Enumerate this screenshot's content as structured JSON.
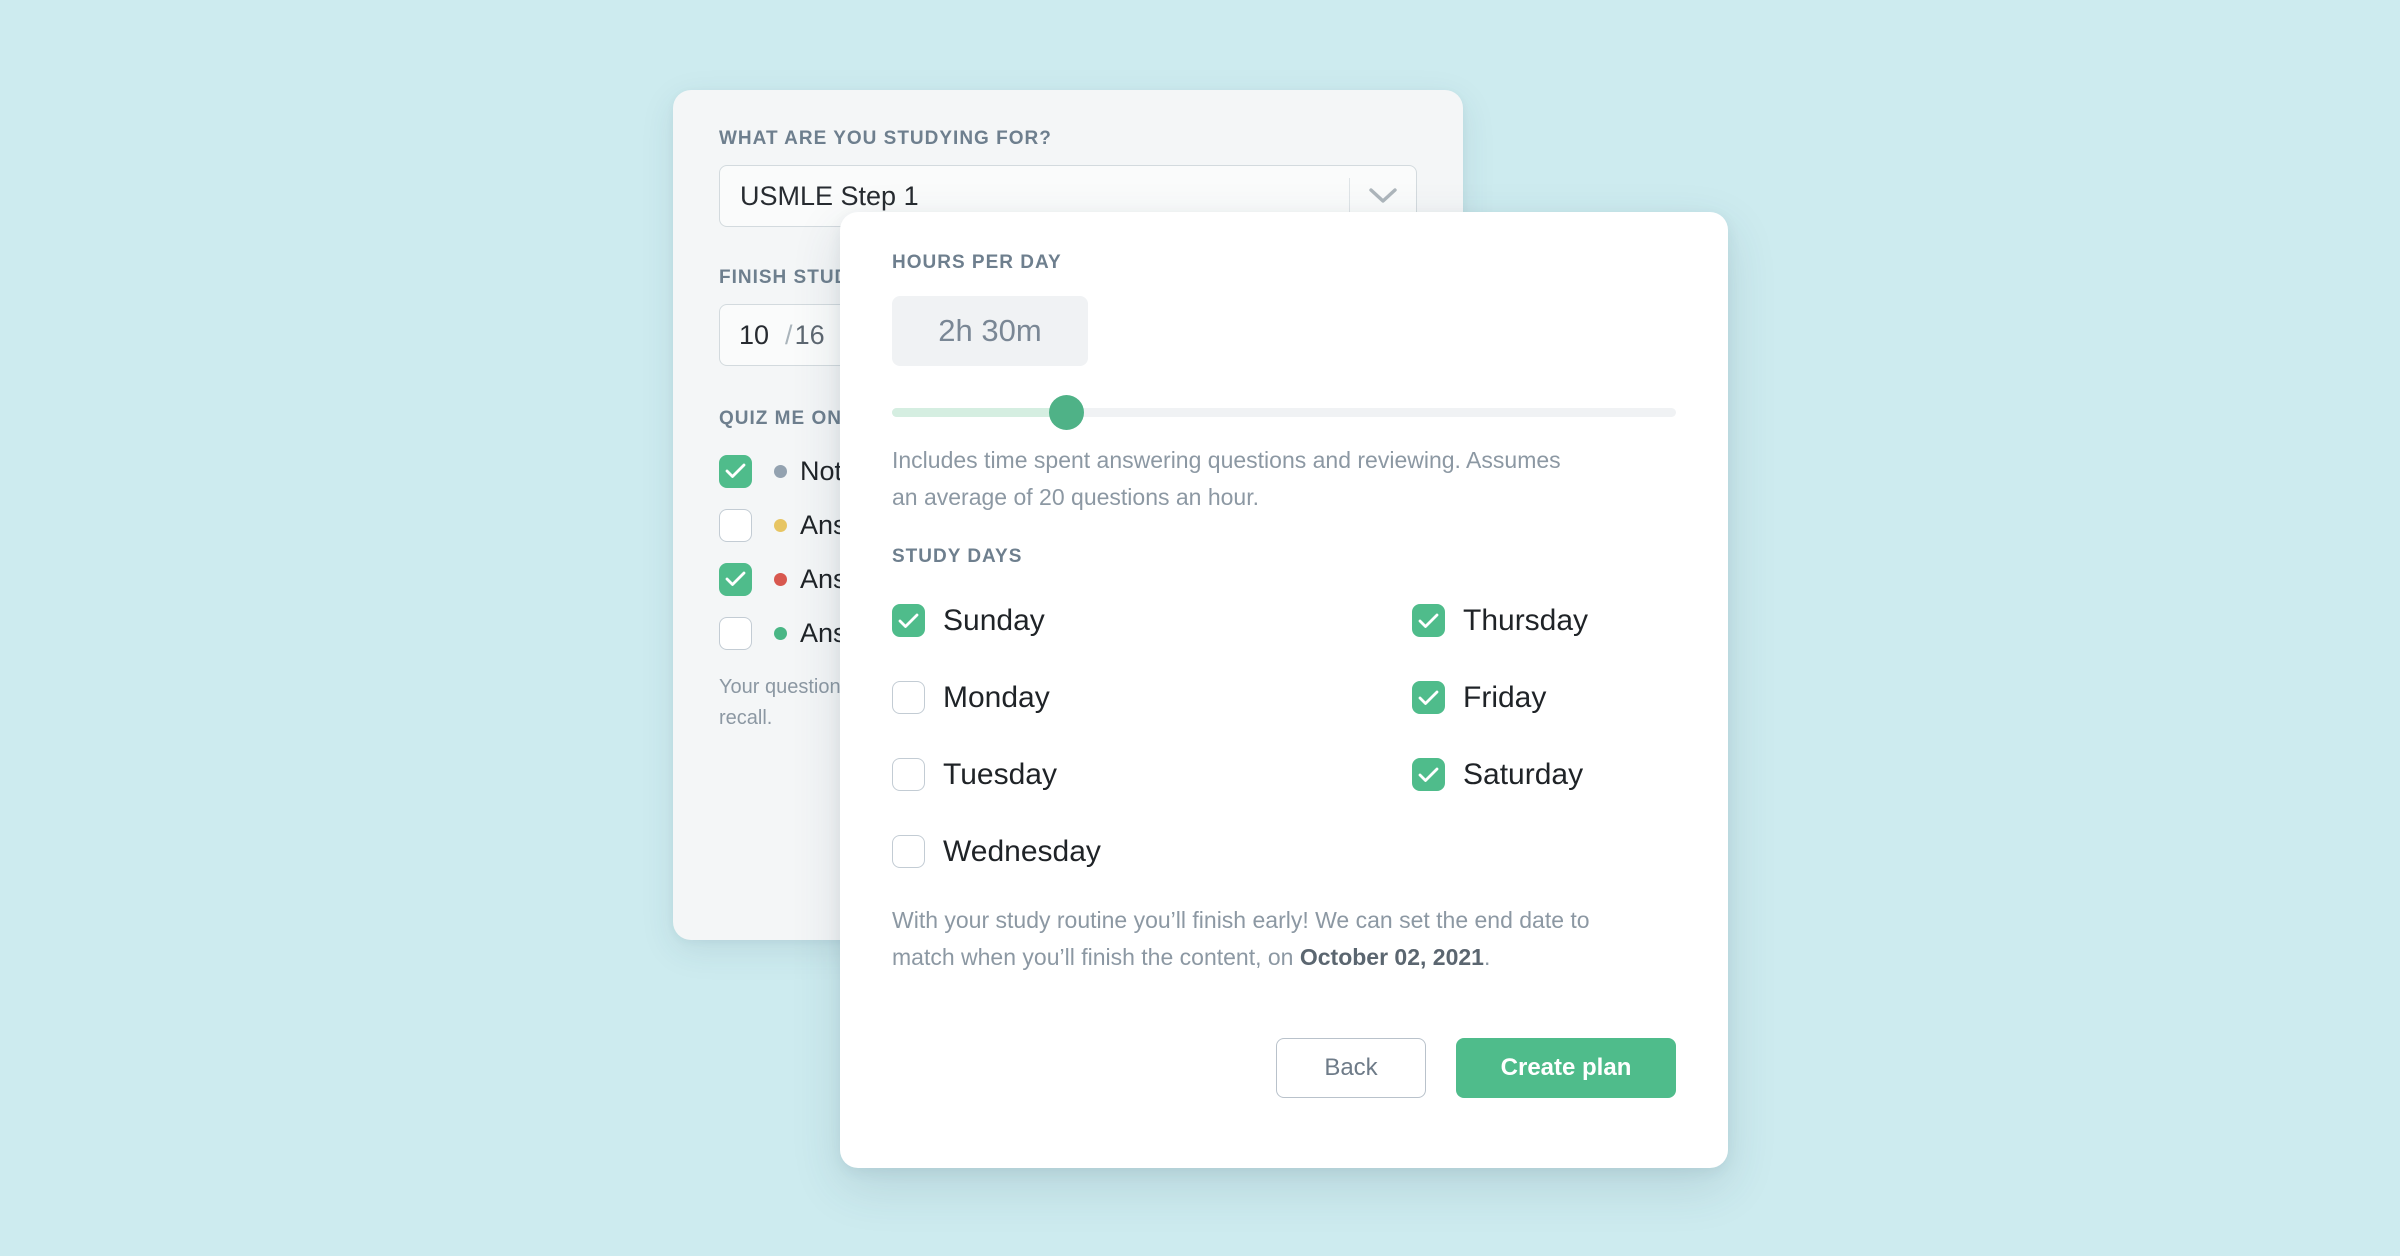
{
  "background_card": {
    "exam": {
      "label": "WHAT ARE YOU STUDYING FOR?",
      "value": "USMLE Step 1",
      "chevron_icon": "chevron-down-icon"
    },
    "finish": {
      "label": "FINISH STUD",
      "current": "10",
      "separator": "/",
      "total": "16"
    },
    "quiz": {
      "label": "QUIZ ME ON",
      "items": [
        {
          "text": "Not",
          "checked": true,
          "dot_color": "#93a2b0"
        },
        {
          "text": "Ans",
          "checked": false,
          "dot_color": "#e7c563"
        },
        {
          "text": "Ans",
          "checked": true,
          "dot_color": "#d8584f"
        },
        {
          "text": "Ans",
          "checked": false,
          "dot_color": "#49b685"
        }
      ],
      "note_line_1": "Your question",
      "note_line_2": "recall."
    }
  },
  "modal": {
    "hours": {
      "label": "HOURS PER DAY",
      "value": "2h 30m",
      "note": "Includes time spent answering questions and reviewing. Assumes an average of 20 questions an hour.",
      "slider": {
        "percent": 21,
        "fill_color": "#d5eee1",
        "track_color": "#f0f2f4",
        "handle_color": "#4fb287"
      }
    },
    "study_days": {
      "label": "STUDY DAYS",
      "left_column": [
        {
          "name": "Sunday",
          "checked": true
        },
        {
          "name": "Monday",
          "checked": false
        },
        {
          "name": "Tuesday",
          "checked": false
        },
        {
          "name": "Wednesday",
          "checked": false
        }
      ],
      "right_column": [
        {
          "name": "Thursday",
          "checked": true
        },
        {
          "name": "Friday",
          "checked": true
        },
        {
          "name": "Saturday",
          "checked": true
        }
      ]
    },
    "finish_note": {
      "prefix": "With your study routine you’ll finish early! We can set the end date to match when you’ll finish the content, on ",
      "date": "October 02, 2021",
      "suffix": "."
    },
    "actions": {
      "back_label": "Back",
      "create_label": "Create plan"
    }
  },
  "theme": {
    "page_background": "#cdebef",
    "accent_green": "#4fbc8b",
    "label_gray": "#6e7f8e",
    "muted_text": "#8c98a3"
  }
}
